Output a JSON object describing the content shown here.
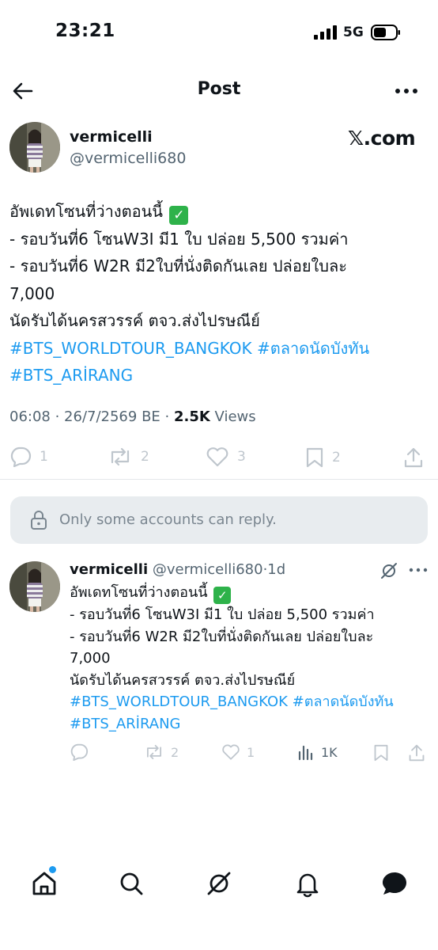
{
  "status_bar": {
    "time": "23:21",
    "network": "5G"
  },
  "header": {
    "title": "Post"
  },
  "post": {
    "author_name": "vermicelli",
    "author_handle": "@vermicelli680",
    "source_brand": "𝕏.com",
    "body": {
      "line1": "อัพเดทโซนที่ว่างตอนนี้",
      "line2": "- รอบวันที่6 โซนW3I มี1 ใบ ปล่อย 5,500 รวมค่า",
      "line3": "- รอบวันที่6 W2R มี2ใบที่นั่งติดกันเลย ปล่อยใบละ",
      "line4": "7,000",
      "line5": "นัดรับได้นครสวรรค์ ตจว.ส่งไปรษณีย์",
      "hashtag1": "#BTS_WORLDTOUR_BANGKOK",
      "hashtag2": "#ตลาดนัดบังทัน",
      "hashtag3": "#BTS_ARİRANG"
    },
    "meta": {
      "time": "06:08",
      "date": "26/7/2569 BE",
      "views_count": "2.5K",
      "views_label": "Views"
    },
    "counts": {
      "replies": "1",
      "reposts": "2",
      "likes": "3",
      "bookmarks": "2"
    }
  },
  "reply_restriction": {
    "text": "Only some accounts can reply."
  },
  "reply_post": {
    "author_name": "vermicelli",
    "author_handle": "@vermicelli680",
    "age": "1d",
    "counts": {
      "reposts": "2",
      "likes": "1",
      "views": "1K"
    }
  },
  "icons": [
    "back-arrow-icon",
    "more-icon",
    "check-mark-icon",
    "reply-icon",
    "repost-icon",
    "like-icon",
    "bookmark-icon",
    "share-icon",
    "lock-icon",
    "grok-icon",
    "views-icon",
    "home-icon",
    "search-icon",
    "grok-tab-icon",
    "notifications-icon",
    "messages-icon"
  ],
  "colors": {
    "accent": "#1d9bf0",
    "text": "#0f1419",
    "secondary": "#536471",
    "check": "#2eb24a"
  }
}
